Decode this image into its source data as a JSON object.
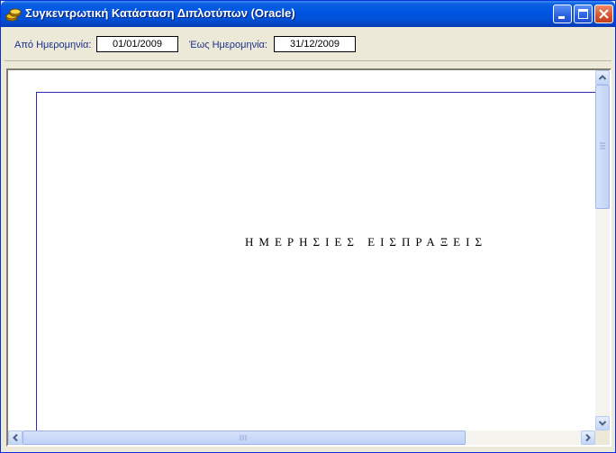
{
  "window": {
    "title": "Συγκεντρωτική Κατάσταση Διπλοτύπων (Oracle)",
    "icon": "coins-icon"
  },
  "filters": {
    "from_label": "Από Ημερομηνία:",
    "from_value": "01/01/2009",
    "to_label": "Έως Ημερομηνία:",
    "to_value": "31/12/2009"
  },
  "report": {
    "title": "ΗΜΕΡΗΣΙΕΣ ΕΙΣΠΡΑΞΕΙΣ"
  },
  "colors": {
    "titlebar": "#0054e3",
    "label_text": "#1a2f8a",
    "page_border": "#2b2bb5"
  }
}
